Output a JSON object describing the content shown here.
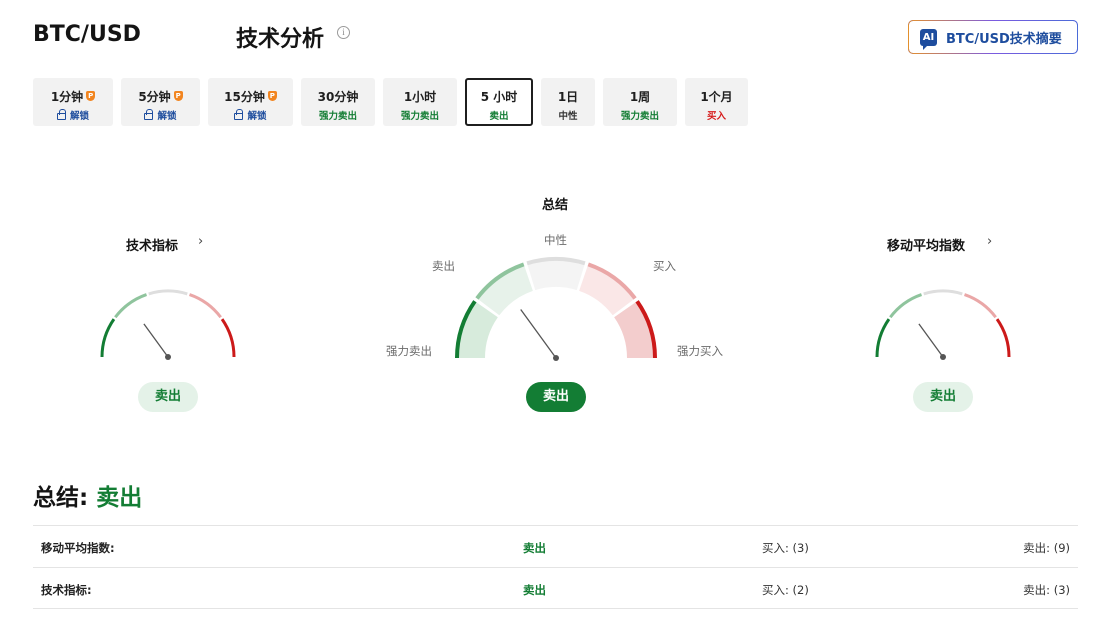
{
  "header": {
    "pair": "BTC/USD",
    "section_title": "技术分析",
    "info_glyph": "i",
    "ai_badge": "AI",
    "ai_summary_label": "BTC/USD技术摘要"
  },
  "tabs": [
    {
      "label": "1分钟",
      "status": "解锁",
      "locked": true,
      "active": false
    },
    {
      "label": "5分钟",
      "status": "解锁",
      "locked": true,
      "active": false
    },
    {
      "label": "15分钟",
      "status": "解锁",
      "locked": true,
      "active": false
    },
    {
      "label": "30分钟",
      "status": "强力卖出",
      "locked": false,
      "active": false,
      "tone": "sell"
    },
    {
      "label": "1小时",
      "status": "强力卖出",
      "locked": false,
      "active": false,
      "tone": "sell"
    },
    {
      "label": "5 小时",
      "status": "卖出",
      "locked": false,
      "active": true,
      "tone": "sell"
    },
    {
      "label": "1日",
      "status": "中性",
      "locked": false,
      "active": false,
      "tone": "neutral"
    },
    {
      "label": "1周",
      "status": "强力卖出",
      "locked": false,
      "active": false,
      "tone": "sell"
    },
    {
      "label": "1个月",
      "status": "买入",
      "locked": false,
      "active": false,
      "tone": "buy"
    }
  ],
  "gauges": {
    "technical": {
      "title": "技术指标",
      "chevron": "›",
      "verdict": "卖出"
    },
    "summary": {
      "title": "总结",
      "verdict": "卖出",
      "labels": {
        "neutral": "中性",
        "sell": "卖出",
        "buy": "买入",
        "strong_sell": "强力卖出",
        "strong_buy": "强力买入"
      }
    },
    "moving_averages": {
      "title": "移动平均指数",
      "chevron": "›",
      "verdict": "卖出"
    }
  },
  "summary": {
    "label": "总结:",
    "verdict": "卖出",
    "rows": [
      {
        "name": "移动平均指数:",
        "verdict": "卖出",
        "buy": "买入: (3)",
        "sell": "卖出: (9)"
      },
      {
        "name": "技术指标:",
        "verdict": "卖出",
        "buy": "买入: (2)",
        "sell": "卖出: (3)"
      }
    ]
  },
  "colors": {
    "strong_sell": "#137d34",
    "sell": "#8fc49d",
    "neutral": "#dedede",
    "buy": "#eaa7a7",
    "strong_buy": "#cc1a1a",
    "needle": "#555555"
  },
  "icons": [
    "info-icon",
    "ai-icon",
    "pro-icon",
    "lock-icon",
    "chevron-right-icon"
  ]
}
